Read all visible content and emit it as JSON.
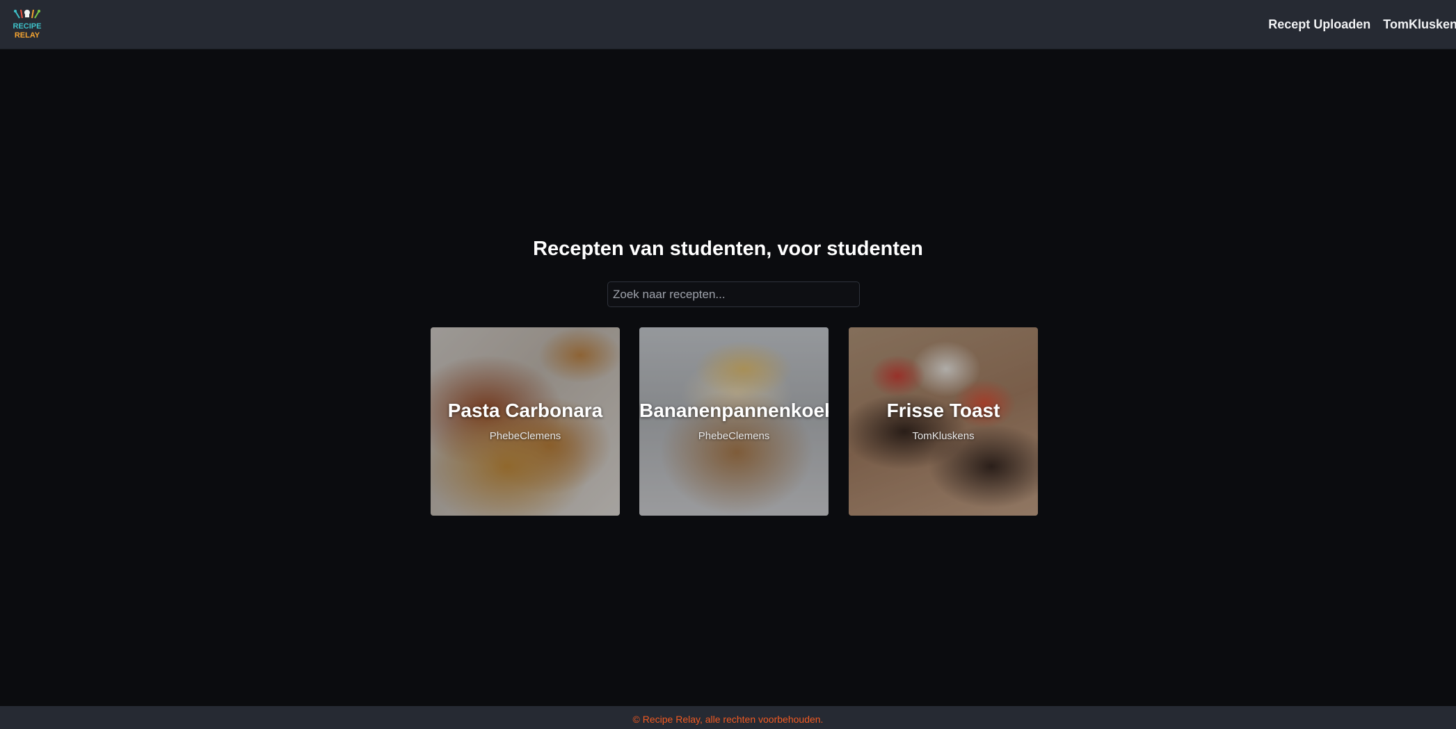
{
  "header": {
    "logo": {
      "text": "RECIPE RELAY",
      "icon": "recipe-relay-logo"
    },
    "nav": {
      "upload_label": "Recept Uploaden",
      "user_label": "TomKluskens"
    }
  },
  "main": {
    "title": "Recepten van studenten, voor studenten",
    "search": {
      "placeholder": "Zoek naar recepten...",
      "value": ""
    },
    "recipes": [
      {
        "title": "Pasta Carbonara",
        "author": "PhebeClemens"
      },
      {
        "title": "Bananenpannenkoek",
        "author": "PhebeClemens"
      },
      {
        "title": "Frisse Toast",
        "author": "TomKluskens"
      }
    ]
  },
  "footer": {
    "text": "© Recipe Relay, alle rechten voorbehouden."
  },
  "colors": {
    "header_bg": "#262a33",
    "page_bg": "#0b0c0f",
    "footer_text": "#f05a22"
  }
}
